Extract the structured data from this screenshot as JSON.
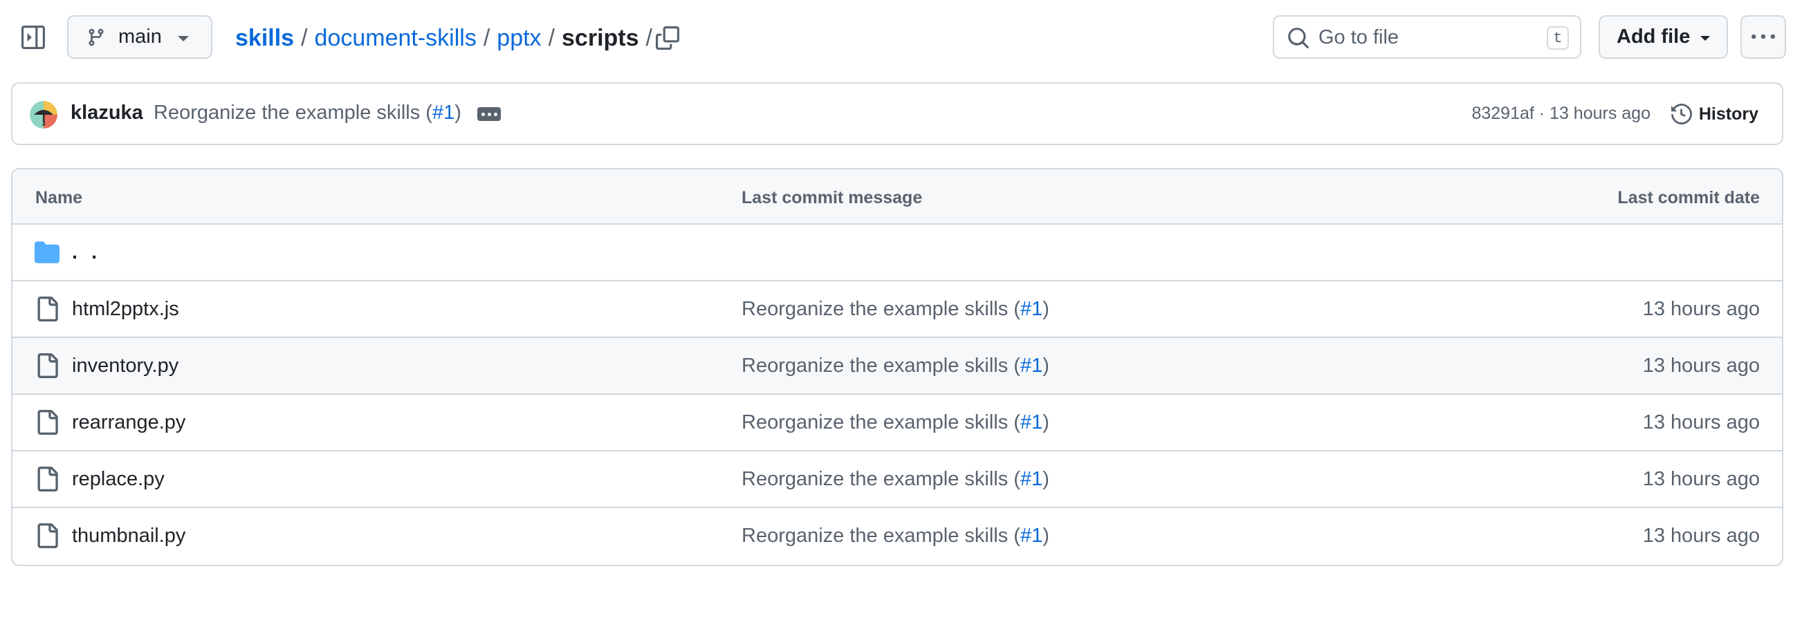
{
  "topbar": {
    "branch": "main",
    "breadcrumb": {
      "root": "skills",
      "path": [
        "document-skills",
        "pptx"
      ],
      "current": "scripts",
      "separator": "/"
    },
    "search": {
      "placeholder": "Go to file",
      "shortcut": "t"
    },
    "add_file_label": "Add file"
  },
  "commit": {
    "author": "klazuka",
    "message": "Reorganize the example skills (",
    "pr_link": "#1",
    "message_end": ")",
    "sha": "83291af",
    "meta_sep": " · ",
    "time": "13 hours ago",
    "history_label": "History"
  },
  "table": {
    "headers": {
      "name": "Name",
      "message": "Last commit message",
      "date": "Last commit date"
    },
    "parent_label": ". .",
    "rows": [
      {
        "name": "html2pptx.js",
        "message": "Reorganize the example skills (",
        "pr": "#1",
        "message_end": ")",
        "date": "13 hours ago"
      },
      {
        "name": "inventory.py",
        "message": "Reorganize the example skills (",
        "pr": "#1",
        "message_end": ")",
        "date": "13 hours ago"
      },
      {
        "name": "rearrange.py",
        "message": "Reorganize the example skills (",
        "pr": "#1",
        "message_end": ")",
        "date": "13 hours ago"
      },
      {
        "name": "replace.py",
        "message": "Reorganize the example skills (",
        "pr": "#1",
        "message_end": ")",
        "date": "13 hours ago"
      },
      {
        "name": "thumbnail.py",
        "message": "Reorganize the example skills (",
        "pr": "#1",
        "message_end": ")",
        "date": "13 hours ago"
      }
    ],
    "hovered_row": 1
  },
  "colors": {
    "link": "#0969da",
    "text": "#1f2328",
    "muted": "#59636e",
    "border": "#d1d9e0",
    "header_bg": "#f6f8fa",
    "folder": "#54aeff"
  },
  "icons": {
    "sidebar_toggle": "sidebar-expand-icon",
    "branch": "git-branch-icon",
    "copy": "copy-icon",
    "search": "search-icon",
    "more": "kebab-horizontal-icon",
    "history": "history-icon",
    "folder": "folder-icon",
    "file": "file-icon"
  }
}
